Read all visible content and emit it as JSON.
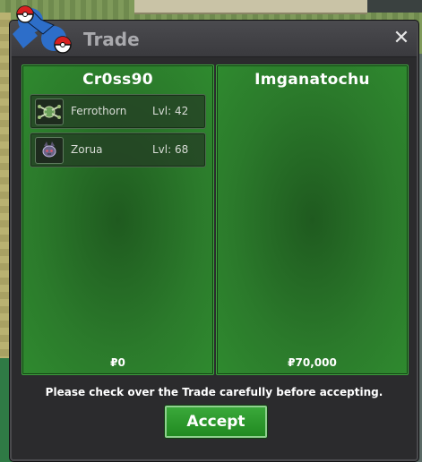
{
  "window": {
    "title": "Trade",
    "close_icon": "close-icon"
  },
  "left_panel": {
    "player_name": "Cr0ss90",
    "pokemon": [
      {
        "name": "Ferrothorn",
        "level": "Lvl: 42",
        "icon": "ferrothorn-icon"
      },
      {
        "name": "Zorua",
        "level": "Lvl: 68",
        "icon": "zorua-icon"
      }
    ],
    "money": "₽0"
  },
  "right_panel": {
    "player_name": "Imganatochu",
    "pokemon": [],
    "money": "₽70,000"
  },
  "footer": {
    "notice": "Please check over the Trade carefully before accepting.",
    "accept_label": "Accept"
  },
  "colors": {
    "panel_green": "#2b7a2b",
    "accept_green": "#2a9a2a",
    "window_bg": "#2b2b2d"
  }
}
